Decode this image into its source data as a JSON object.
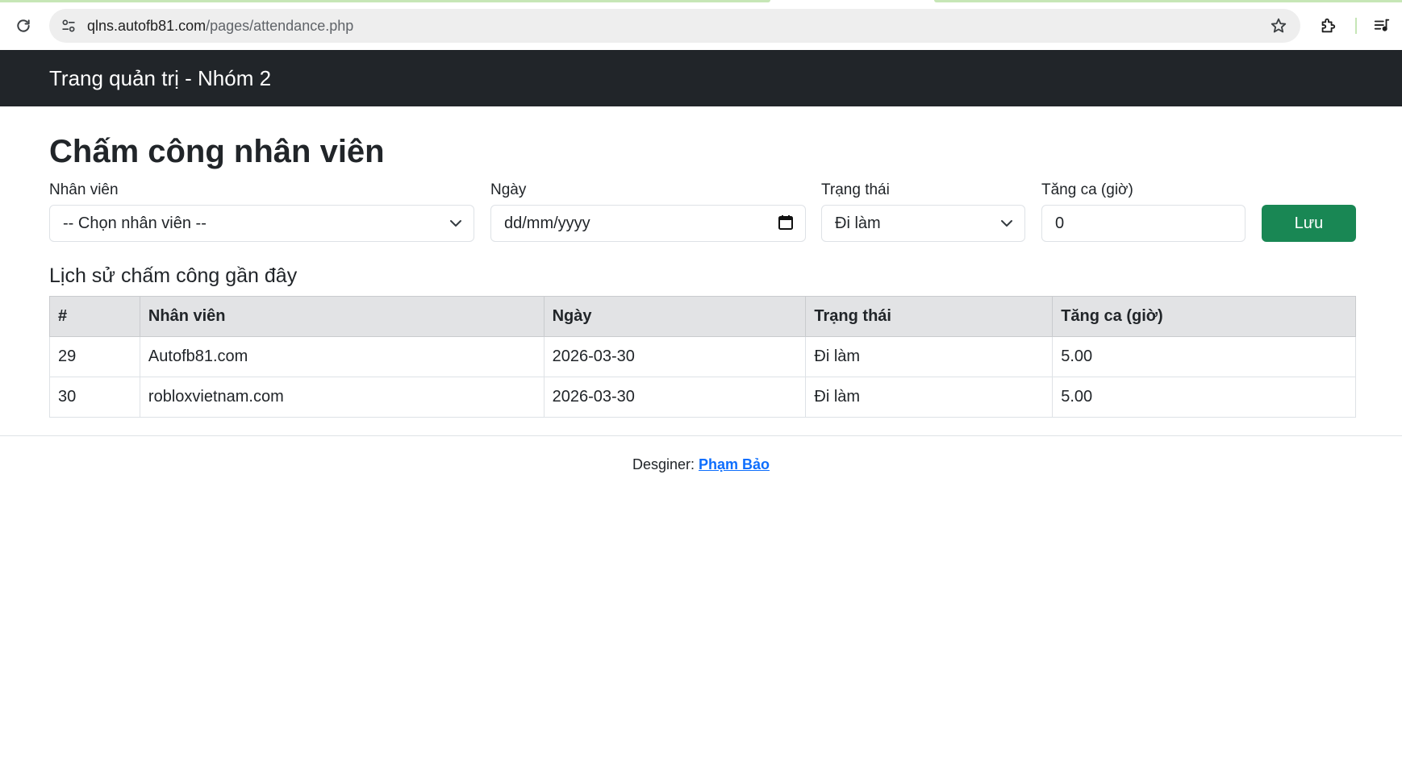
{
  "browser": {
    "url_host": "qlns.autofb81.com",
    "url_path": "/pages/attendance.php",
    "icons": [
      "reload-icon",
      "site-settings-icon",
      "bookmark-star-icon",
      "extensions-icon",
      "media-controls-icon"
    ]
  },
  "navbar": {
    "brand": "Trang quản trị - Nhóm 2"
  },
  "page": {
    "title": "Chấm công nhân viên"
  },
  "form": {
    "employee": {
      "label": "Nhân viên",
      "value": "-- Chọn nhân viên --"
    },
    "date": {
      "label": "Ngày",
      "placeholder": "dd/mm/yyyy"
    },
    "status": {
      "label": "Trạng thái",
      "value": "Đi làm"
    },
    "overtime": {
      "label": "Tăng ca (giờ)",
      "value": "0"
    },
    "save_label": "Lưu"
  },
  "history": {
    "title": "Lịch sử chấm công gần đây",
    "headers": [
      "#",
      "Nhân viên",
      "Ngày",
      "Trạng thái",
      "Tăng ca (giờ)"
    ],
    "rows": [
      [
        "29",
        "Autofb81.com",
        "2026-03-30",
        "Đi làm",
        "5.00"
      ],
      [
        "30",
        "robloxvietnam.com",
        "2026-03-30",
        "Đi làm",
        "5.00"
      ]
    ]
  },
  "footer": {
    "prefix": "Desginer: ",
    "author": "Phạm Bảo"
  },
  "colors": {
    "navbar": "#212529",
    "save_button": "#198754",
    "link": "#0d6efd",
    "table_header": "#e2e3e5"
  }
}
